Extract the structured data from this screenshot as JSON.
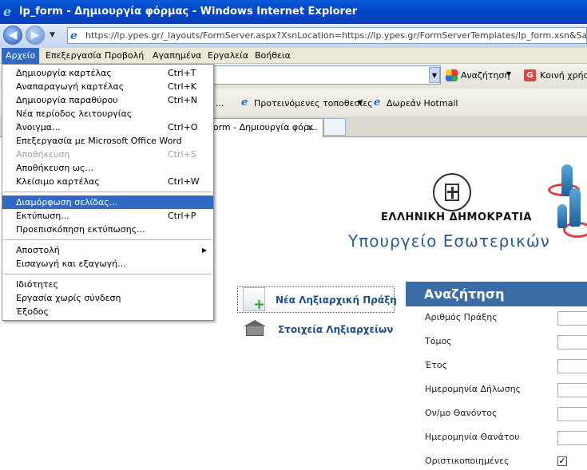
{
  "window": {
    "title": "lp_form - Δημιουργία φόρμας - Windows Internet Explorer"
  },
  "address": {
    "url": "https://lp.ypes.gr/_layouts/FormServer.aspx?XsnLocation=https://lp.ypes.gr/FormServerTemplates/lp_form.xsn&SaveLocation=h"
  },
  "menubar": {
    "items": [
      "Αρχείο",
      "Επεξεργασία",
      "Προβολή",
      "Αγαπημένα",
      "Εργαλεία",
      "Βοήθεια"
    ]
  },
  "toolbar": {
    "search_label": "Αναζήτηση",
    "share_label": "Κοινή χρήση"
  },
  "favorites": {
    "ellipsis": "...",
    "suggested": "Προτεινόμενες τοποθεσίες",
    "hotmail": "Δωρεάν Hotmail"
  },
  "tab": {
    "title": "form - Δημιουργία φόρ...",
    "close": "x"
  },
  "file_menu": {
    "items": [
      {
        "label": "Δημιουργία καρτέλας",
        "shortcut": "Ctrl+T"
      },
      {
        "label": "Αναπαραγωγή καρτέλας",
        "shortcut": "Ctrl+K"
      },
      {
        "label": "Δημιουργία παραθύρου",
        "shortcut": "Ctrl+N"
      },
      {
        "label": "Νέα περίοδος λειτουργίας",
        "shortcut": ""
      },
      {
        "label": "Άνοιγμα...",
        "shortcut": "Ctrl+O"
      },
      {
        "label": "Επεξεργασία με Microsoft Office Word",
        "shortcut": ""
      },
      {
        "label": "Αποθήκευση",
        "shortcut": "Ctrl+S"
      },
      {
        "label": "Αποθήκευση ως...",
        "shortcut": ""
      },
      {
        "label": "Κλείσιμο καρτέλας",
        "shortcut": "Ctrl+W"
      },
      {
        "label": "Διαμόρφωση σελίδας...",
        "shortcut": ""
      },
      {
        "label": "Εκτύπωση...",
        "shortcut": "Ctrl+P"
      },
      {
        "label": "Προεπισκόπηση εκτύπωσης...",
        "shortcut": ""
      },
      {
        "label": "Αποστολή",
        "shortcut": ""
      },
      {
        "label": "Εισαγωγή και εξαγωγή...",
        "shortcut": ""
      },
      {
        "label": "Ιδιότητες",
        "shortcut": ""
      },
      {
        "label": "Εργασία χωρίς σύνδεση",
        "shortcut": ""
      },
      {
        "label": "Έξοδος",
        "shortcut": ""
      }
    ],
    "submenu_arrow": "▶",
    "highlighted": "Διαμόρφωση σελίδας...",
    "disabled": "Αποθήκευση"
  },
  "page": {
    "republic": "ΕΛΛΗΝΙΚΗ ΔΗΜΟΚΡΑΤΙΑ",
    "ministry": "Υπουργείο Εσωτερικών",
    "new_record": "Νέα Ληξιαρχική Πράξη",
    "registry_info": "Στοιχεία Ληξιαρχείων",
    "search_title": "Αναζήτηση",
    "fields": [
      "Αριθμός Πράξης",
      "Τόμος",
      "Έτος",
      "Ημερομηνία Δήλωσης",
      "Ον/μο Θανόντος",
      "Ημερομηνία Θανάτου"
    ],
    "finalized_label": "Οριστικοποιημένες",
    "finalized_checked": "✓"
  },
  "colors": {
    "accent": "#316ac5",
    "header": "#3b6da6",
    "title_blue": "#2c5a99"
  }
}
